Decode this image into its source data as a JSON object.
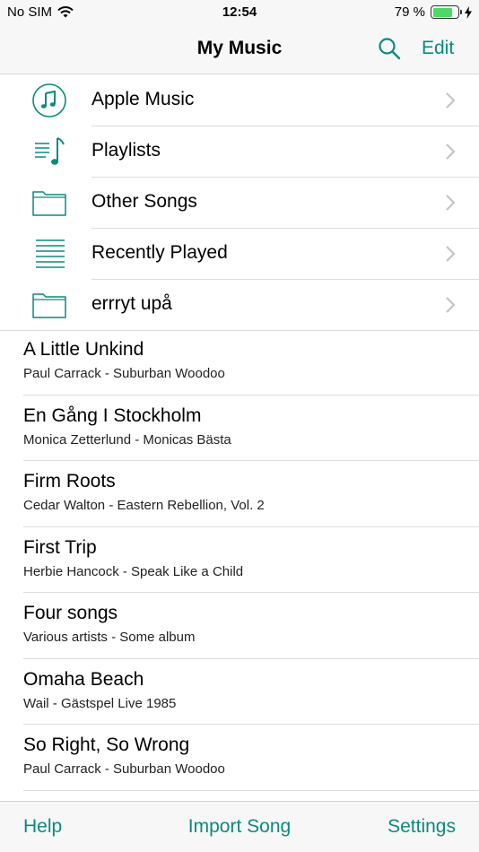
{
  "colors": {
    "accent": "#0a8a7e",
    "battery": "#4cd964"
  },
  "status_bar": {
    "carrier": "No SIM",
    "time": "12:54",
    "battery_text": "79 %",
    "battery_level": 0.79
  },
  "nav": {
    "title": "My Music",
    "search_icon": "search-icon",
    "edit_label": "Edit"
  },
  "folders": [
    {
      "label": "Apple Music",
      "icon": "music-note-circle-icon"
    },
    {
      "label": "Playlists",
      "icon": "playlist-icon"
    },
    {
      "label": "Other Songs",
      "icon": "folder-icon"
    },
    {
      "label": "Recently Played",
      "icon": "list-lines-icon"
    },
    {
      "label": "errryt upå",
      "icon": "folder-icon"
    }
  ],
  "songs": [
    {
      "title": "A Little Unkind",
      "subtitle": "Paul Carrack - Suburban Woodoo"
    },
    {
      "title": "En Gång I Stockholm",
      "subtitle": "Monica Zetterlund - Monicas Bästa"
    },
    {
      "title": "Firm Roots",
      "subtitle": "Cedar Walton - Eastern Rebellion, Vol. 2"
    },
    {
      "title": "First Trip",
      "subtitle": "Herbie Hancock - Speak Like a Child"
    },
    {
      "title": "Four songs",
      "subtitle": "Various artists - Some album"
    },
    {
      "title": "Omaha Beach",
      "subtitle": "Wail - Gästspel Live 1985"
    },
    {
      "title": "So Right, So Wrong",
      "subtitle": "Paul Carrack - Suburban Woodoo"
    }
  ],
  "toolbar": {
    "help_label": "Help",
    "import_label": "Import Song",
    "settings_label": "Settings"
  }
}
